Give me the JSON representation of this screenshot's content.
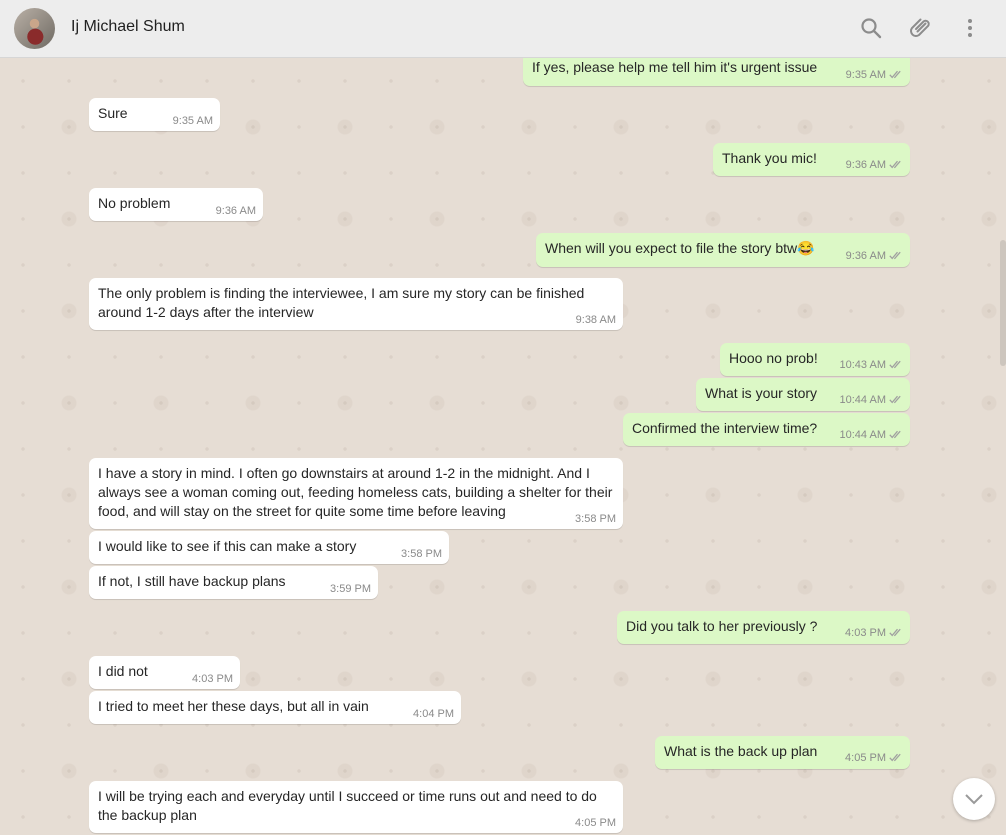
{
  "header": {
    "contact_name": "Ij Michael Shum",
    "icons": [
      "search-icon",
      "attach-icon",
      "menu-icon"
    ]
  },
  "messages": [
    {
      "dir": "out",
      "text": "If yes, please help me tell him it's urgent issue",
      "time": "9:35 AM"
    },
    {
      "dir": "in",
      "text": "Sure",
      "time": "9:35 AM"
    },
    {
      "dir": "out",
      "text": "Thank you mic!",
      "time": "9:36 AM"
    },
    {
      "dir": "in",
      "text": "No problem",
      "time": "9:36 AM"
    },
    {
      "dir": "out",
      "text": "When will you expect to file the story btw😂",
      "time": "9:36 AM"
    },
    {
      "dir": "in",
      "text": "The only problem is finding the interviewee, I am sure my story can be finished around 1-2 days after the interview",
      "time": "9:38 AM"
    },
    {
      "dir": "out",
      "text": "Hooo no prob!",
      "time": "10:43 AM"
    },
    {
      "dir": "out",
      "text": "What is your story",
      "time": "10:44 AM"
    },
    {
      "dir": "out",
      "text": "Confirmed the interview time?",
      "time": "10:44 AM"
    },
    {
      "dir": "in",
      "text": "I have a story in mind. I often go downstairs at around 1-2 in the midnight. And I always see a woman coming out, feeding homeless cats, building a shelter for their food, and will stay on the street for quite some time before leaving",
      "time": "3:58 PM"
    },
    {
      "dir": "in",
      "text": "I would like to see if this can make a story",
      "time": "3:58 PM"
    },
    {
      "dir": "in",
      "text": "If not, I still have backup plans",
      "time": "3:59 PM"
    },
    {
      "dir": "out",
      "text": "Did you talk to her previously ?",
      "time": "4:03 PM"
    },
    {
      "dir": "in",
      "text": "I did not",
      "time": "4:03 PM"
    },
    {
      "dir": "in",
      "text": "I tried to meet her these days, but all in vain",
      "time": "4:04 PM"
    },
    {
      "dir": "out",
      "text": "What is the back up plan",
      "time": "4:05 PM"
    },
    {
      "dir": "in",
      "text": "I will be trying each and everyday until I succeed or time runs out and need to do the backup plan",
      "time": "4:05 PM"
    }
  ],
  "colors": {
    "incoming_bubble": "#ffffff",
    "outgoing_bubble": "#dcf8c6",
    "chat_background": "#e6ddd4",
    "read_ticks": "#a0a0a0"
  }
}
